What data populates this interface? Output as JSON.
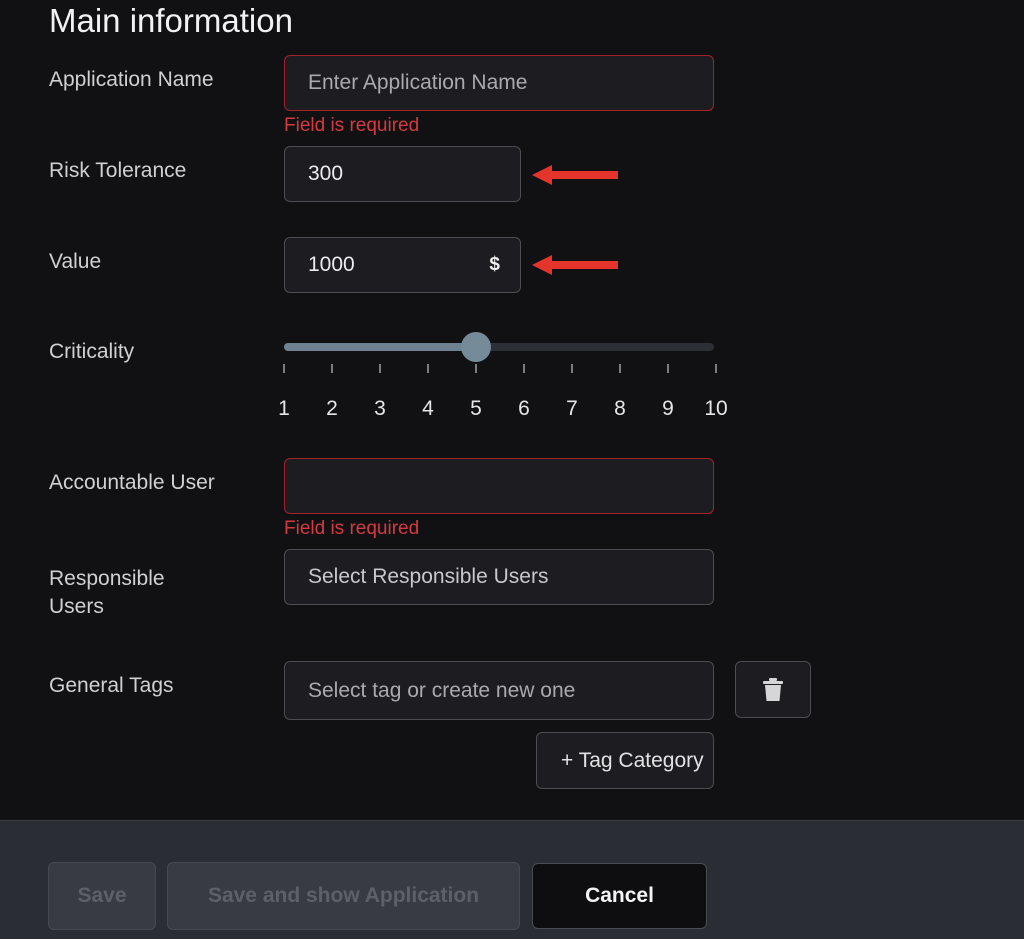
{
  "section_title": "Main information",
  "fields": {
    "application_name": {
      "label": "Application Name",
      "placeholder": "Enter Application Name",
      "error": "Field is required"
    },
    "risk_tolerance": {
      "label": "Risk Tolerance",
      "value": "300"
    },
    "value": {
      "label": "Value",
      "value": "1000",
      "currency": "$"
    },
    "criticality": {
      "label": "Criticality",
      "value": 5,
      "min": 1,
      "max": 10,
      "tick_labels": [
        "1",
        "2",
        "3",
        "4",
        "5",
        "6",
        "7",
        "8",
        "9",
        "10"
      ]
    },
    "accountable_user": {
      "label": "Accountable User",
      "value": "",
      "error": "Field is required"
    },
    "responsible_users": {
      "label_line1": "Responsible",
      "label_line2": "Users",
      "placeholder": "Select Responsible Users"
    },
    "general_tags": {
      "label": "General Tags",
      "placeholder": "Select tag or create new one",
      "delete_icon": "trash-icon",
      "add_category_label": "+ Tag Category"
    }
  },
  "annotations": {
    "arrow_icon": "left-arrow-icon",
    "arrow_color": "#e5342b"
  },
  "footer": {
    "save_label": "Save",
    "save_and_show_label": "Save and show Application",
    "cancel_label": "Cancel"
  },
  "colors": {
    "background": "#111113",
    "error": "#d43a3f",
    "slider": "#758b99",
    "footer": "#2b2d34"
  }
}
